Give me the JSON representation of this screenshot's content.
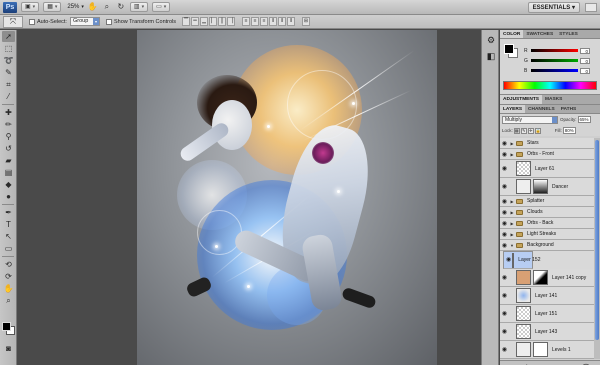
{
  "appbar": {
    "logo": "Ps",
    "zoom": "25%",
    "workspace": "ESSENTIALS",
    "dropdown_glyph": "▾"
  },
  "options": {
    "auto_select_label": "Auto-Select:",
    "auto_select_value": "Group",
    "show_transform_label": "Show Transform Controls"
  },
  "panels": {
    "color_tabs": [
      "COLOR",
      "SWATCHES",
      "STYLES"
    ],
    "color": {
      "channels": [
        {
          "label": "R",
          "value": "0",
          "color": "#ff0000"
        },
        {
          "label": "G",
          "value": "0",
          "color": "#00aa00"
        },
        {
          "label": "B",
          "value": "0",
          "color": "#0000ff"
        }
      ]
    },
    "adjust_tabs": [
      "ADJUSTMENTS",
      "MASKS"
    ],
    "layers_tabs": [
      "LAYERS",
      "CHANNELS",
      "PATHS"
    ],
    "blend_mode": "Multiply",
    "opacity_label": "Opacity:",
    "opacity_value": "65%",
    "lock_label": "Lock:",
    "fill_label": "Fill:",
    "fill_value": "80%",
    "layers": [
      {
        "name": "Stars",
        "kind": "folder"
      },
      {
        "name": "Orbs - Front",
        "kind": "folder"
      },
      {
        "name": "Layer 61",
        "kind": "layer"
      },
      {
        "name": "Dancer",
        "kind": "layer-mask"
      },
      {
        "name": "Splatter",
        "kind": "folder"
      },
      {
        "name": "Clouds",
        "kind": "folder"
      },
      {
        "name": "Orbs - Back",
        "kind": "folder"
      },
      {
        "name": "Light Streaks",
        "kind": "folder"
      },
      {
        "name": "Background",
        "kind": "folder-open"
      },
      {
        "name": "Layer 152",
        "kind": "layer",
        "selected": true
      },
      {
        "name": "Layer 141 copy",
        "kind": "layer-mask"
      },
      {
        "name": "Layer 141",
        "kind": "layer"
      },
      {
        "name": "Layer 151",
        "kind": "layer"
      },
      {
        "name": "Layer 143",
        "kind": "layer"
      },
      {
        "name": "Levels 1",
        "kind": "adjustment"
      }
    ]
  },
  "colors": {
    "accent": "#4e7bc6",
    "selected_layer": "#b7cdf2"
  }
}
